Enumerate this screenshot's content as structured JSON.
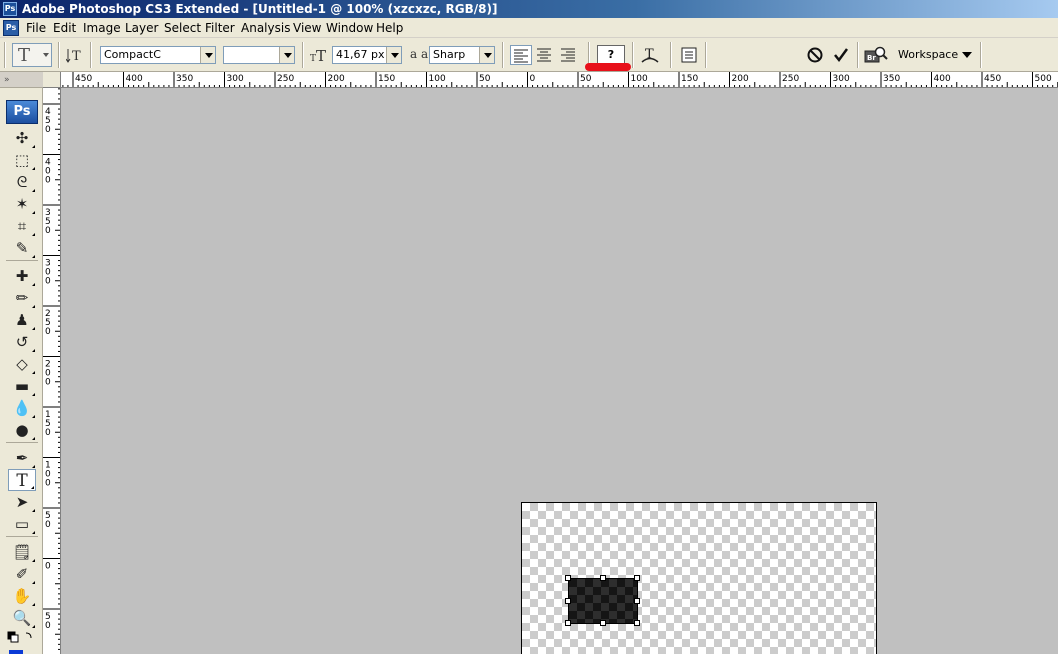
{
  "window": {
    "title": "Adobe Photoshop CS3 Extended - [Untitled-1 @ 100% (xzcxzc, RGB/8)]",
    "app_icon": "Ps"
  },
  "menu": [
    "File",
    "Edit",
    "Image",
    "Layer",
    "Select",
    "Filter",
    "Analysis",
    "View",
    "Window",
    "Help"
  ],
  "options_bar": {
    "tool_preset_icon": "T",
    "font_family": "CompactC",
    "font_style": "",
    "font_size": "41,67 px",
    "antialias_icon_text": "a a",
    "antialias": "Sharp",
    "text_color_swatch": "?",
    "workspace_label": "Workspace",
    "icons": [
      "type-tool-preset-icon",
      "text-orientation-icon",
      "font-size-icon",
      "antialias-icon",
      "align-left-icon",
      "align-center-icon",
      "align-right-icon",
      "warp-text-icon",
      "character-palette-icon",
      "cancel-icon",
      "commit-icon",
      "bridge-icon"
    ]
  },
  "annotation": {
    "color": "#e8101a",
    "target": "text-color-swatch"
  },
  "toolbox": {
    "logo": "Ps",
    "grip_text": "»",
    "active_tool": "type-tool",
    "tools": [
      {
        "name": "move-tool",
        "glyph": "✣"
      },
      {
        "name": "marquee-tool",
        "glyph": "⬚"
      },
      {
        "name": "lasso-tool",
        "glyph": "ᘓ"
      },
      {
        "name": "magic-wand-tool",
        "glyph": "✶"
      },
      {
        "name": "crop-tool",
        "glyph": "⌗"
      },
      {
        "name": "slice-tool",
        "glyph": "✎"
      },
      {
        "name": "healing-brush-tool",
        "glyph": "✚"
      },
      {
        "name": "brush-tool",
        "glyph": "✏"
      },
      {
        "name": "clone-stamp-tool",
        "glyph": "♟"
      },
      {
        "name": "history-brush-tool",
        "glyph": "↺"
      },
      {
        "name": "eraser-tool",
        "glyph": "◇"
      },
      {
        "name": "gradient-tool",
        "glyph": "▬"
      },
      {
        "name": "blur-tool",
        "glyph": "💧"
      },
      {
        "name": "dodge-tool",
        "glyph": "●"
      },
      {
        "name": "pen-tool",
        "glyph": "✒"
      },
      {
        "name": "type-tool",
        "glyph": "T"
      },
      {
        "name": "path-selection-tool",
        "glyph": "➤"
      },
      {
        "name": "shape-tool",
        "glyph": "▭"
      },
      {
        "name": "notes-tool",
        "glyph": "🗒"
      },
      {
        "name": "eyedropper-tool",
        "glyph": "✐"
      },
      {
        "name": "hand-tool",
        "glyph": "✋"
      },
      {
        "name": "zoom-tool",
        "glyph": "🔍"
      }
    ]
  },
  "rulers": {
    "horizontal": [
      "450",
      "400",
      "350",
      "300",
      "250",
      "200",
      "150",
      "100",
      "50",
      "0",
      "50",
      "100",
      "150",
      "200",
      "250",
      "300",
      "350",
      "400",
      "450",
      "500"
    ],
    "vertical": [
      "4 5 0",
      "4 0 0",
      "3 5 0",
      "3 0 0",
      "2 5 0",
      "2 0 0",
      "1 5 0",
      "1 0 0",
      "5 0",
      "0",
      "5 0"
    ]
  },
  "canvas": {
    "background": "#c0c0c0",
    "document_layer": "xzcxzc"
  }
}
